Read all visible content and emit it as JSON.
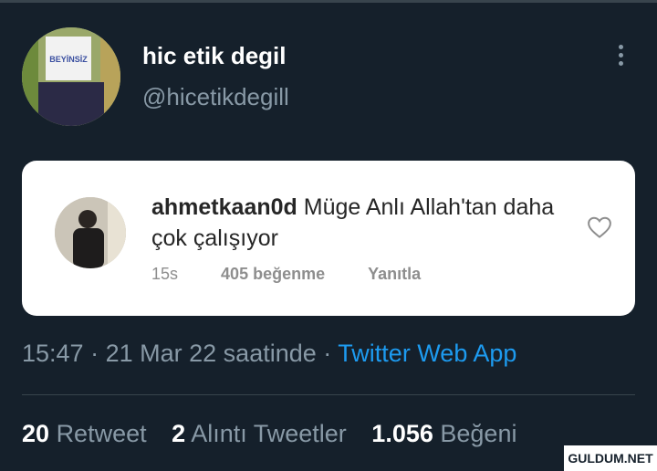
{
  "author": {
    "display_name": "hic etik degil",
    "handle": "@hicetikdegill",
    "avatar_sign": "BEYİNSİZ"
  },
  "embedded_comment": {
    "username": "ahmetkaan0d",
    "text": "Müge Anlı Allah'tan daha çok çalışıyor",
    "age": "15s",
    "likes": "405 beğenme",
    "reply": "Yanıtla"
  },
  "meta": {
    "time": "15:47",
    "date": "21 Mar 22 saatinde",
    "separator": "·",
    "app": "Twitter Web App"
  },
  "stats": {
    "retweets_count": "20",
    "retweets_label": "Retweet",
    "quotes_count": "2",
    "quotes_label": "Alıntı Tweetler",
    "likes_count": "1.056",
    "likes_label": "Beğeni"
  },
  "watermark": "GULDUM.NET",
  "colors": {
    "background": "#15202b",
    "secondary_text": "#8899a6",
    "link": "#1d9bf0",
    "card": "#ffffff"
  }
}
